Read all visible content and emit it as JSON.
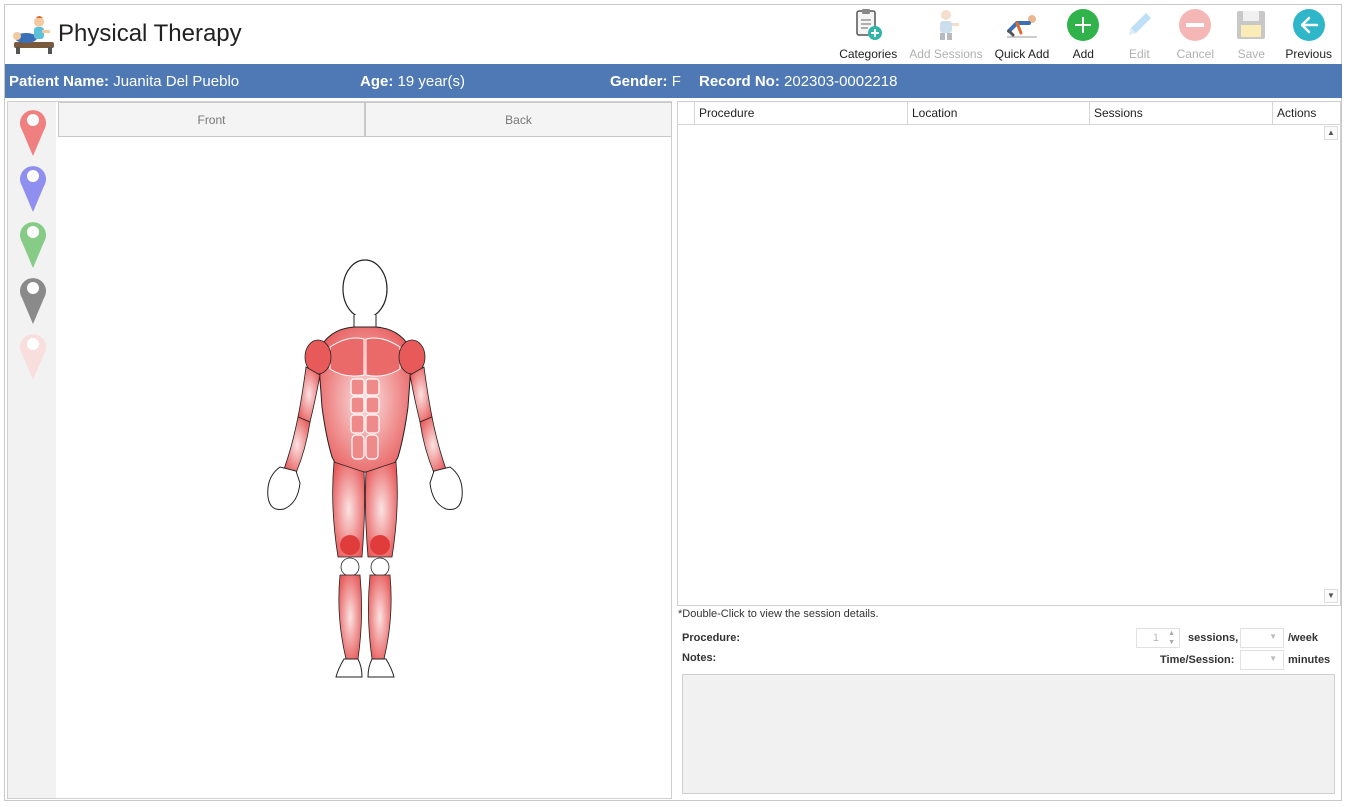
{
  "app": {
    "title": "Physical Therapy"
  },
  "toolbar": {
    "categories": "Categories",
    "add_sessions": "Add Sessions",
    "quick_add": "Quick Add",
    "add": "Add",
    "edit": "Edit",
    "cancel": "Cancel",
    "save": "Save",
    "previous": "Previous"
  },
  "patient": {
    "name_label": "Patient Name:",
    "name": "Juanita Del Pueblo",
    "age_label": "Age:",
    "age": "19 year(s)",
    "gender_label": "Gender:",
    "gender": "F",
    "record_label": "Record No:",
    "record": "202303-0002218"
  },
  "colors": {
    "header_bar": "#4f79b4",
    "pin_red": "#f08080",
    "pin_blue": "#8f8ff0",
    "pin_green": "#86cc86",
    "pin_gray": "#8a8a8a",
    "pin_pink": "#f9dede",
    "add_green": "#2fb34a",
    "previous_teal": "#2fb6c8",
    "muscle": "#e85a5a"
  },
  "view_tabs": {
    "front": "Front",
    "back": "Back"
  },
  "grid": {
    "columns": [
      "Procedure",
      "Location",
      "Sessions",
      "Actions"
    ]
  },
  "hint": "*Double-Click to view the session details.",
  "form": {
    "procedure_label": "Procedure:",
    "notes_label": "Notes:",
    "sessions_value": "1",
    "sessions_label": "sessions,",
    "week_label": "/week",
    "time_label": "Time/Session:",
    "minutes_label": "minutes"
  }
}
